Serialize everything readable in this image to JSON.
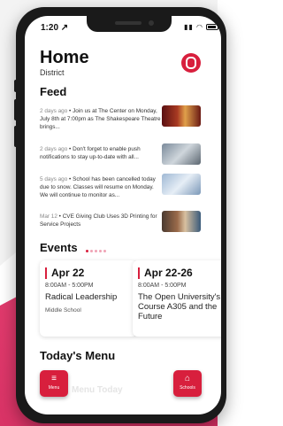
{
  "status": {
    "time": "1:20 ↗"
  },
  "header": {
    "title": "Home",
    "subtitle": "District"
  },
  "feed": {
    "heading": "Feed",
    "items": [
      {
        "meta": "2 days ago",
        "text": "Join us at The Center on Monday, July 8th at 7:00pm as The Shakespeare Theatre brings..."
      },
      {
        "meta": "2 days ago",
        "text": "Don't forget to enable push notifications to stay up-to-date with all..."
      },
      {
        "meta": "5 days ago",
        "text": "School has been cancelled today due to snow. Classes will resume on Monday. We will continue to monitor as..."
      },
      {
        "meta": "Mar 12",
        "text": "CVE Giving Club Uses 3D Printing for Service Projects"
      }
    ]
  },
  "events": {
    "heading": "Events",
    "cards": [
      {
        "date": "Apr 22",
        "time": "8:00AM - 5:00PM",
        "name": "Radical Leadership",
        "location": "Middle School"
      },
      {
        "date": "Apr 22-26",
        "time": "8:00AM - 5:00PM",
        "name": "The Open University's Course A305 and the Future",
        "location": ""
      }
    ]
  },
  "menu_section": {
    "heading": "Today's Menu",
    "peek": "Menu Today"
  },
  "bottom_nav": {
    "menu_label": "Menu",
    "schools_label": "Schools"
  },
  "colors": {
    "accent": "#d81f3d",
    "background_pink": "#e03a6c"
  }
}
